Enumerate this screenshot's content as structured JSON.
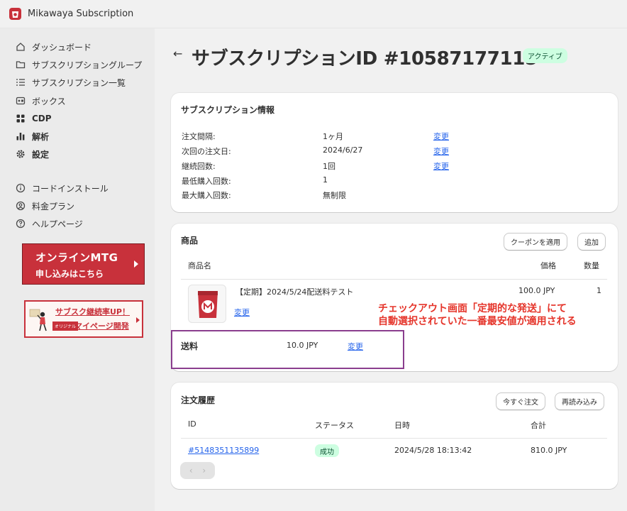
{
  "app": {
    "title": "Mikawaya Subscription"
  },
  "sidebar": {
    "items": [
      {
        "label": "ダッシュボード",
        "icon": "home-icon"
      },
      {
        "label": "サブスクリプショングループ",
        "icon": "folder-icon"
      },
      {
        "label": "サブスクリプション一覧",
        "icon": "list-icon"
      },
      {
        "label": "ボックス",
        "icon": "box-icon"
      },
      {
        "label": "CDP",
        "icon": "grid-icon"
      },
      {
        "label": "解析",
        "icon": "bar-chart-icon"
      },
      {
        "label": "設定",
        "icon": "gear-icon"
      }
    ],
    "secondary": [
      {
        "label": "コードインストール",
        "icon": "info-icon"
      },
      {
        "label": "料金プラン",
        "icon": "user-circle-icon"
      },
      {
        "label": "ヘルプページ",
        "icon": "help-icon"
      }
    ],
    "banner1": {
      "line1": "オンラインMTG",
      "line2": "申し込みはこちら"
    },
    "banner2": {
      "line1": "サブスク継続率UP！",
      "tag": "オリジナル",
      "line2": "マイページ開発"
    }
  },
  "page": {
    "title": "サブスクリプションID #10587177115",
    "status": "アクティブ"
  },
  "info": {
    "title": "サブスクリプション情報",
    "rows": [
      {
        "label": "注文間隔:",
        "value": "1ヶ月",
        "action": "変更"
      },
      {
        "label": "次回の注文日:",
        "value": "2024/6/27",
        "action": "変更"
      },
      {
        "label": "継続回数:",
        "value": "1回",
        "action": "変更"
      },
      {
        "label": "最低購入回数:",
        "value": "1",
        "action": ""
      },
      {
        "label": "最大購入回数:",
        "value": "無制限",
        "action": ""
      }
    ]
  },
  "products": {
    "title": "商品",
    "coupon_button": "クーポンを適用",
    "add_button": "追加",
    "columns": {
      "name": "商品名",
      "price": "価格",
      "qty": "数量"
    },
    "item": {
      "name": "【定期】2024/5/24配送料テスト",
      "edit": "変更",
      "price": "100.0 JPY",
      "qty": "1"
    },
    "shipping": {
      "label": "送料",
      "value": "10.0 JPY",
      "action": "変更"
    },
    "annotation": {
      "line1": "チェックアウト画面「定期的な発送」にて",
      "line2": "自動選択されていた一番最安値が適用される"
    }
  },
  "orders": {
    "title": "注文履歴",
    "order_now_button": "今すぐ注文",
    "reload_button": "再読み込み",
    "columns": {
      "id": "ID",
      "status": "ステータス",
      "date": "日時",
      "total": "合計"
    },
    "rows": [
      {
        "id": "#5148351135899",
        "status": "成功",
        "date": "2024/5/28 18:13:42",
        "total": "810.0 JPY"
      }
    ]
  },
  "colors": {
    "brand": "#c8313b",
    "link": "#2463eb",
    "annotation": "#e5352b",
    "highlight_box": "#8a3e8e",
    "badge_bg": "#cdfee1"
  }
}
